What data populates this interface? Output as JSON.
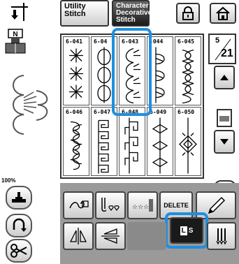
{
  "tabs": {
    "utility": "Utility Stitch",
    "character": "Character Decorative Stitch"
  },
  "page": {
    "current": "5",
    "total": "21"
  },
  "zoom": "100%",
  "stitches": [
    {
      "code": "6-041"
    },
    {
      "code": "6-04"
    },
    {
      "code": "6-043"
    },
    {
      "code": "-044"
    },
    {
      "code": "6-045"
    },
    {
      "code": "6-046"
    },
    {
      "code": "6-047"
    },
    {
      "code": "6-048"
    },
    {
      "code": "6-049"
    },
    {
      "code": "6-050"
    }
  ],
  "buttons": {
    "delete": "DELETE",
    "ls_l": "L",
    "ls_s": "S"
  },
  "colors": {
    "highlight": "#1e8fe0",
    "panel": "#9a9a9a"
  }
}
